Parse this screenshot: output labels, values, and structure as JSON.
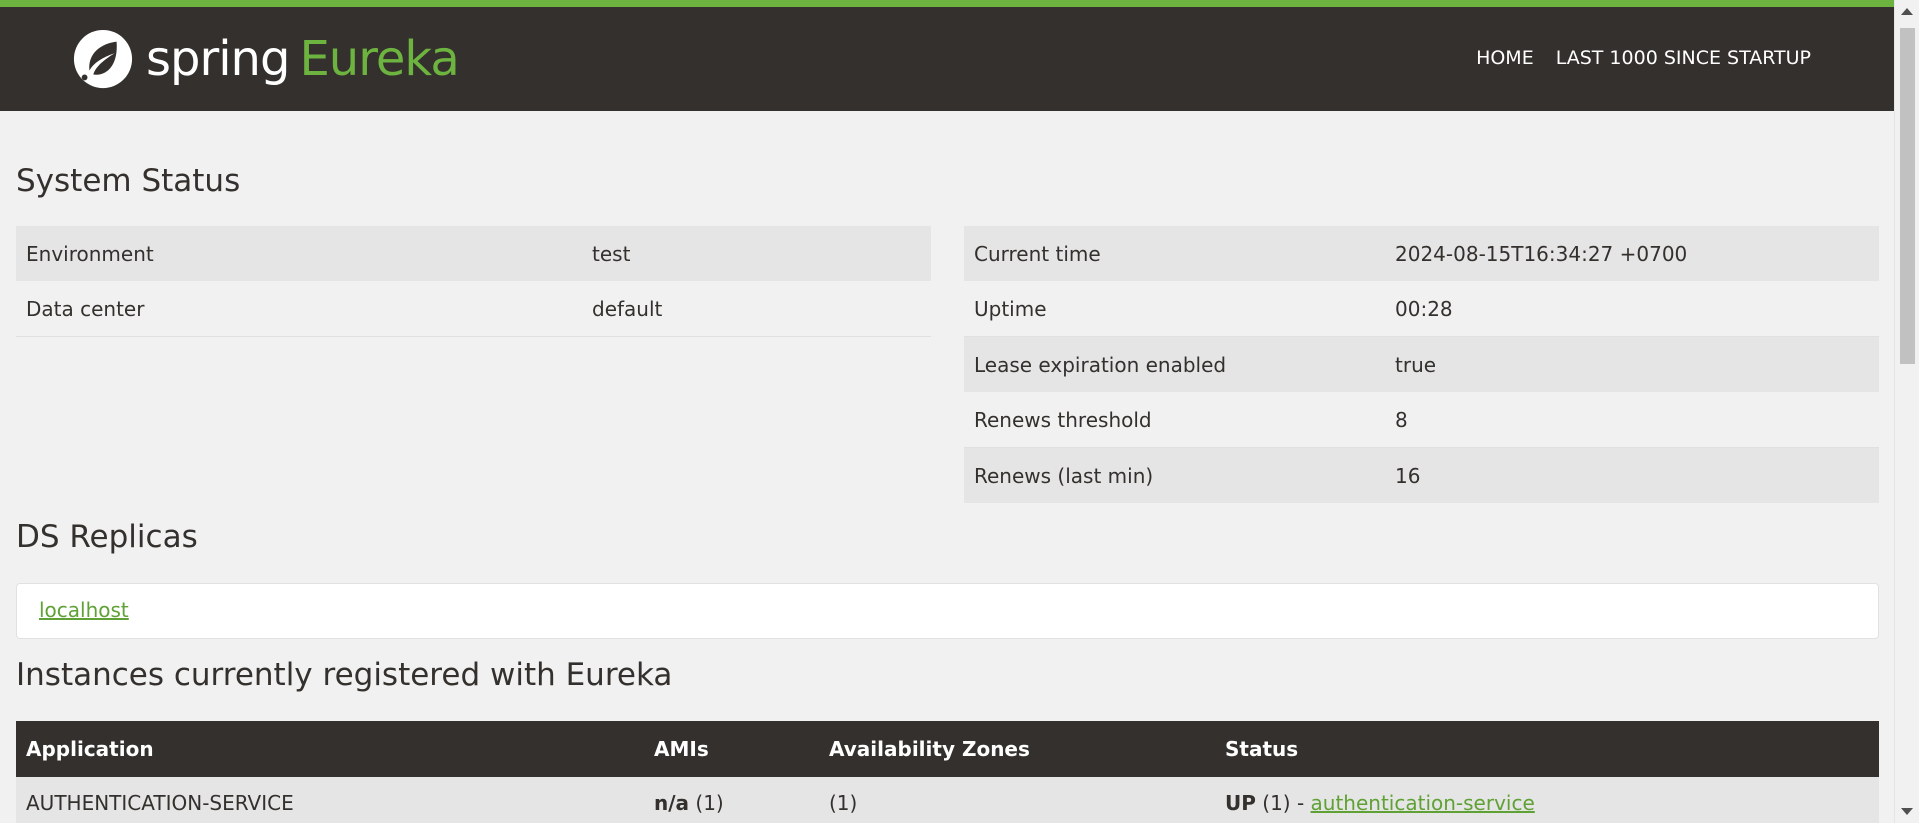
{
  "header": {
    "brand_spring": "spring",
    "brand_eureka": "Eureka",
    "nav": [
      {
        "label": "HOME"
      },
      {
        "label": "LAST 1000 SINCE STARTUP"
      }
    ]
  },
  "system_status": {
    "title": "System Status",
    "left": [
      {
        "key": "Environment",
        "value": "test"
      },
      {
        "key": "Data center",
        "value": "default"
      }
    ],
    "right": [
      {
        "key": "Current time",
        "value": "2024-08-15T16:34:27 +0700"
      },
      {
        "key": "Uptime",
        "value": "00:28"
      },
      {
        "key": "Lease expiration enabled",
        "value": "true"
      },
      {
        "key": "Renews threshold",
        "value": "8"
      },
      {
        "key": "Renews (last min)",
        "value": "16"
      }
    ]
  },
  "ds_replicas": {
    "title": "DS Replicas",
    "link": "localhost"
  },
  "instances": {
    "title": "Instances currently registered with Eureka",
    "headers": [
      "Application",
      "AMIs",
      "Availability Zones",
      "Status"
    ],
    "rows": [
      {
        "application": "AUTHENTICATION-SERVICE",
        "ami_bold": "n/a",
        "ami_count": "(1)",
        "zones": "(1)",
        "status_bold": "UP",
        "status_count": "(1) - ",
        "status_link": "authentication-service"
      }
    ]
  },
  "colors": {
    "accent": "#6db33f",
    "header_bg": "#34302d",
    "page_bg": "#f1f1f1"
  }
}
